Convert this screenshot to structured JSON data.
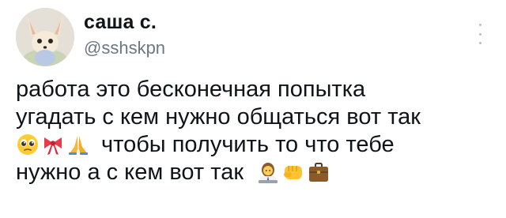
{
  "tweet": {
    "display_name": "саша с.",
    "handle": "@sshskpn",
    "text_lines": {
      "line1": "работа это бесконечная попытка",
      "line2": "угадать с кем нужно общаться вот так",
      "line3": "чтобы получить то что тебе",
      "line4": "нужно а с кем вот так"
    },
    "emojis_line3": [
      "pleading-face",
      "ribbon",
      "folded-hands"
    ],
    "emojis_line4": [
      "woman-office-worker",
      "oncoming-fist",
      "briefcase"
    ]
  },
  "colors": {
    "text": "#0f1419",
    "secondary": "#6b7785"
  }
}
